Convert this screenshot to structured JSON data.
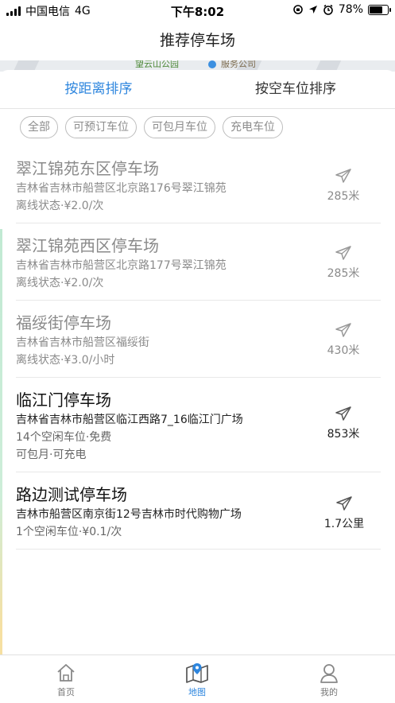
{
  "status_bar": {
    "carrier": "中国电信",
    "network": "4G",
    "time": "下午8:02",
    "battery": "78%",
    "battery_level": 0.78
  },
  "nav": {
    "title": "推荐停车场"
  },
  "map": {
    "label_park": "望云山公园",
    "label_company": "服务公司"
  },
  "sort_tabs": [
    {
      "label": "按距离排序",
      "active": true
    },
    {
      "label": "按空车位排序",
      "active": false
    }
  ],
  "filters": [
    "全部",
    "可预订车位",
    "可包月车位",
    "充电车位"
  ],
  "parkings": [
    {
      "name": "翠江锦苑东区停车场",
      "address": "吉林省吉林市船营区北京路176号翠江锦苑",
      "status": "离线状态·¥2.0/次",
      "extra": "",
      "distance": "285米",
      "active": false
    },
    {
      "name": "翠江锦苑西区停车场",
      "address": "吉林省吉林市船营区北京路177号翠江锦苑",
      "status": "离线状态·¥2.0/次",
      "extra": "",
      "distance": "285米",
      "active": false
    },
    {
      "name": "福绥街停车场",
      "address": "吉林省吉林市船营区福绥街",
      "status": "离线状态·¥3.0/小时",
      "extra": "",
      "distance": "430米",
      "active": false
    },
    {
      "name": "临江门停车场",
      "address": "吉林省吉林市船营区临江西路7_16临江门广场",
      "status": "14个空闲车位·免费",
      "extra": "可包月·可充电",
      "distance": "853米",
      "active": true
    },
    {
      "name": "路边测试停车场",
      "address": "吉林市船营区南京街12号吉林市时代购物广场",
      "status": "1个空闲车位·¥0.1/次",
      "extra": "",
      "distance": "1.7公里",
      "active": true
    }
  ],
  "bottom_tabs": [
    {
      "label": "首页",
      "icon": "home-icon",
      "active": false
    },
    {
      "label": "地图",
      "icon": "map-icon",
      "active": true
    },
    {
      "label": "我的",
      "icon": "user-icon",
      "active": false
    }
  ],
  "colors": {
    "accent": "#2e86de"
  }
}
